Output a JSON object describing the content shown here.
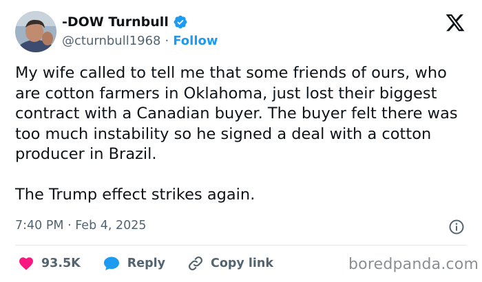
{
  "author": {
    "display_name": "-DOW Turnbull",
    "handle": "@cturnbull1968",
    "separator": "·",
    "follow_label": "Follow",
    "avatar_icon": "avatar-photo",
    "verified_icon": "verified-badge-icon",
    "verified_color": "#1d9bf0"
  },
  "platform": {
    "logo_icon": "x-logo-icon"
  },
  "tweet": {
    "paragraphs": [
      "My wife called to tell me that some friends of ours, who are cotton farmers in Oklahoma, just lost their biggest contract with a Canadian buyer. The buyer felt there was too much instability so he signed a deal with a cotton producer in Brazil.",
      "The Trump effect strikes again."
    ],
    "timestamp": "7:40 PM · Feb 4, 2025",
    "info_icon": "info-icon"
  },
  "actions": {
    "likes": {
      "icon": "heart-icon",
      "count": "93.5K",
      "color": "#f91880"
    },
    "reply": {
      "icon": "reply-bubble-icon",
      "label": "Reply",
      "color": "#1d9bf0"
    },
    "copy_link": {
      "icon": "link-icon",
      "label": "Copy link"
    }
  },
  "watermark": "boredpanda.com"
}
